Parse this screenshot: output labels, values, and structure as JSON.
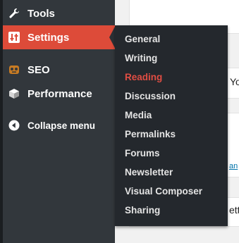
{
  "admin_menu": {
    "items": [
      {
        "label": "Tools",
        "icon": "wrench-icon"
      },
      {
        "label": "Settings",
        "icon": "sliders-icon",
        "active": true
      },
      {
        "label": "SEO",
        "icon": "seo-icon"
      },
      {
        "label": "Performance",
        "icon": "performance-icon"
      }
    ],
    "collapse_label": "Collapse menu"
  },
  "settings_submenu": {
    "items": [
      {
        "label": "General"
      },
      {
        "label": "Writing"
      },
      {
        "label": "Reading",
        "current": true
      },
      {
        "label": "Discussion"
      },
      {
        "label": "Media"
      },
      {
        "label": "Permalinks"
      },
      {
        "label": "Forums"
      },
      {
        "label": "Newsletter"
      },
      {
        "label": "Visual Composer"
      },
      {
        "label": "Sharing"
      }
    ]
  },
  "background": {
    "peek_text_1": "Yo",
    "peek_link": "an",
    "peek_text_2": "etti"
  },
  "colors": {
    "sidebar": "#32373c",
    "active": "#dd4b39",
    "submenu": "#24282d",
    "current_link": "#e14d43"
  }
}
